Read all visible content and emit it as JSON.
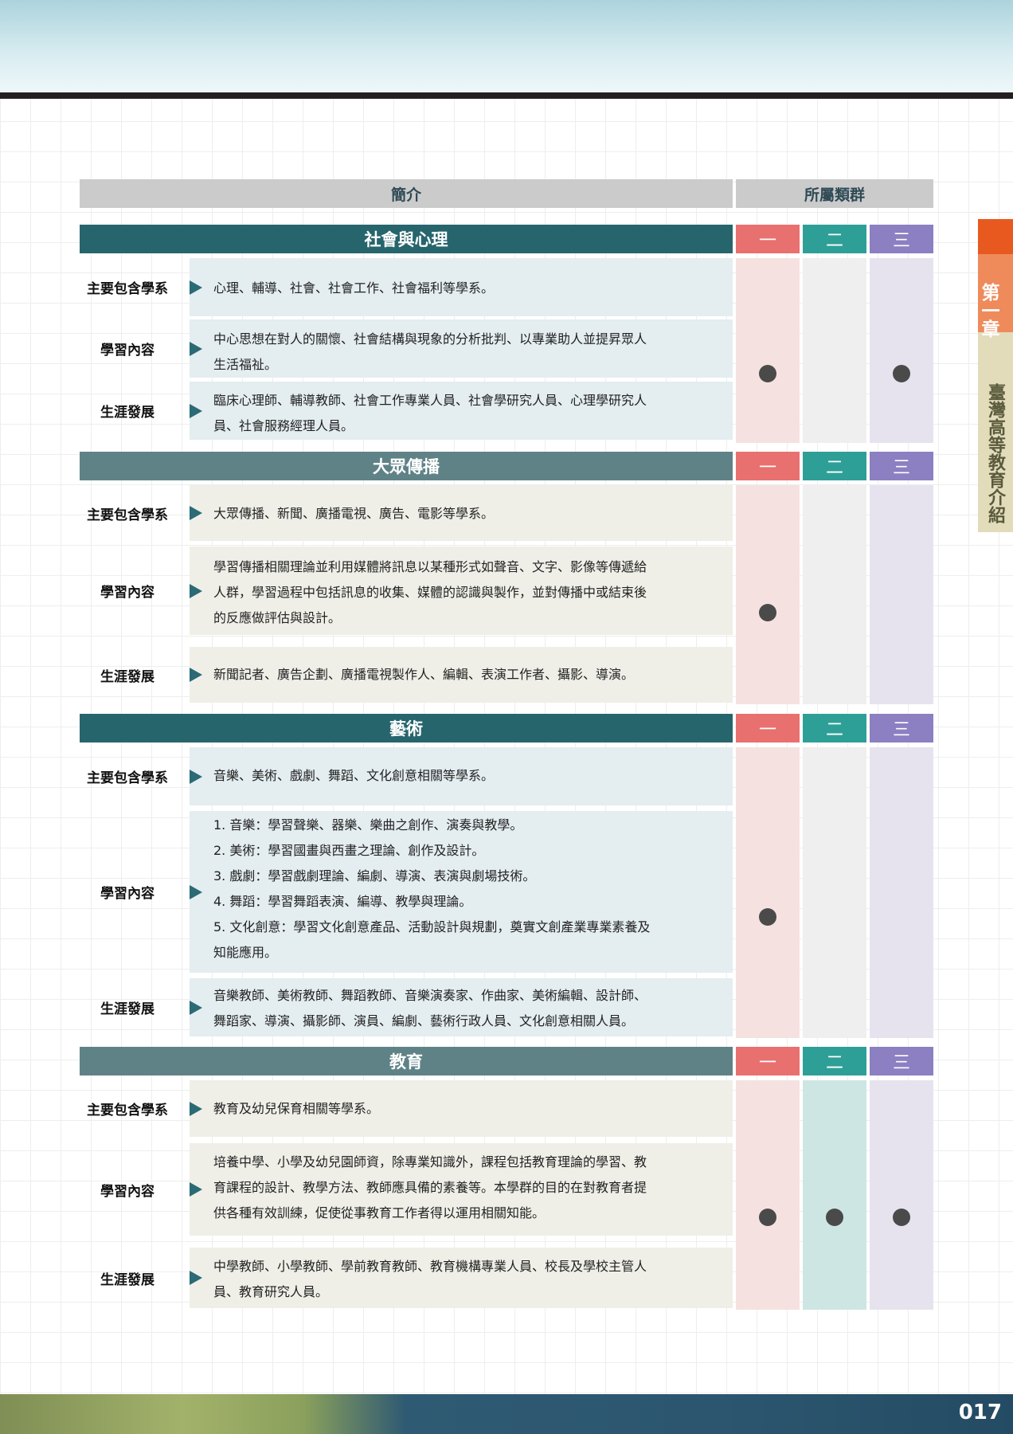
{
  "header": {
    "intro": "簡介",
    "group": "所屬類群"
  },
  "group_labels": [
    "一",
    "二",
    "三"
  ],
  "row_labels": {
    "majors": "主要包含學系",
    "content": "學習內容",
    "career": "生涯發展"
  },
  "sections": [
    {
      "title": "社會與心理",
      "majors": [
        "心理、輔導、社會、社會工作、社會福利等學系。"
      ],
      "content": [
        "中心思想在對人的關懷、社會結構與現象的分析批判、以專業助人並提昇眾人",
        "生活福祉。"
      ],
      "career": [
        "臨床心理師、輔導教師、社會工作專業人員、社會學研究人員、心理學研究人",
        "員、社會服務經理人員。"
      ],
      "groups": [
        true,
        false,
        true
      ]
    },
    {
      "title": "大眾傳播",
      "majors": [
        "大眾傳播、新聞、廣播電視、廣告、電影等學系。"
      ],
      "content": [
        "學習傳播相關理論並利用媒體將訊息以某種形式如聲音、文字、影像等傳遞給",
        "人群，學習過程中包括訊息的收集、媒體的認識與製作，並對傳播中或結束後",
        "的反應做評估與設計。"
      ],
      "career": [
        "新聞記者、廣告企劃、廣播電視製作人、編輯、表演工作者、攝影、導演。"
      ],
      "groups": [
        true,
        false,
        false
      ]
    },
    {
      "title": "藝術",
      "majors": [
        "音樂、美術、戲劇、舞蹈、文化創意相關等學系。"
      ],
      "content": [
        "1. 音樂：學習聲樂、器樂、樂曲之創作、演奏與教學。",
        "2. 美術：學習國畫與西畫之理論、創作及設計。",
        "3. 戲劇：學習戲劇理論、編劇、導演、表演與劇場技術。",
        "4. 舞蹈：學習舞蹈表演、編導、教學與理論。",
        "5. 文化創意：學習文化創意產品、活動設計與規劃，奠實文創產業專業素養及",
        "    知能應用。"
      ],
      "career": [
        "音樂教師、美術教師、舞蹈教師、音樂演奏家、作曲家、美術編輯、設計師、",
        "舞蹈家、導演、攝影師、演員、編劇、藝術行政人員、文化創意相關人員。"
      ],
      "groups": [
        true,
        false,
        false
      ]
    },
    {
      "title": "教育",
      "majors": [
        "教育及幼兒保育相關等學系。"
      ],
      "content": [
        "培養中學、小學及幼兒園師資，除專業知識外，課程包括教育理論的學習、教",
        "育課程的設計、教學方法、教師應具備的素養等。本學群的目的在對教育者提",
        "供各種有效訓練，促使從事教育工作者得以運用相關知能。"
      ],
      "career": [
        "中學教師、小學教師、學前教育教師、教育機構專業人員、校長及學校主管人",
        "員、教育研究人員。"
      ],
      "groups": [
        true,
        true,
        true
      ]
    }
  ],
  "side_tab": {
    "chapter": "第一章",
    "title": "臺灣高等教育介紹"
  },
  "page_number": "017",
  "colors": {
    "bar_dark": "#27656d",
    "bar_light": "#5f8287",
    "group1": "#e8706f",
    "group2": "#2e9f97",
    "group3": "#8c7fc2",
    "col1_bg": "#f6e1e1",
    "col2_bg": "#efefef",
    "col3_bg": "#e6e3ef",
    "col2_active": "#cde6e3",
    "cell_blue": "#e4edf0",
    "cell_beige": "#efefe8"
  }
}
